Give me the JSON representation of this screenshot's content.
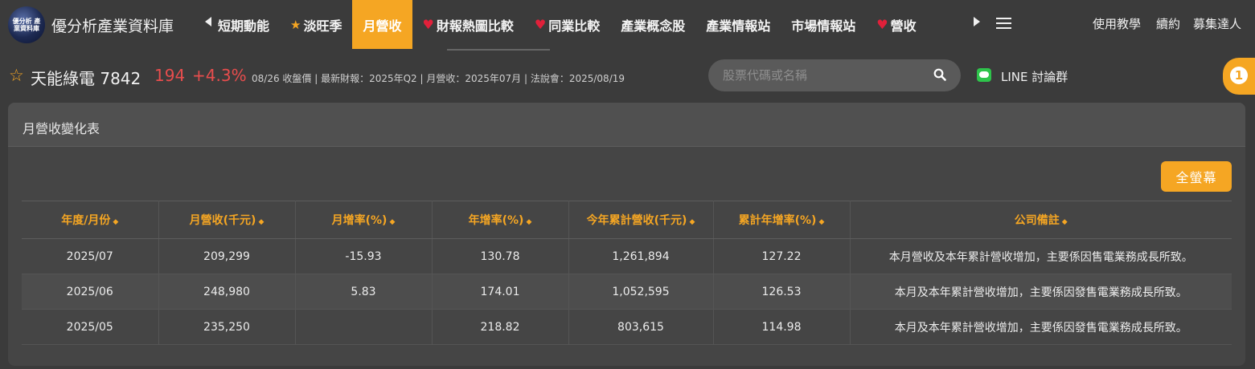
{
  "brand": {
    "logo_text": "優分析 產業資料庫",
    "name": "優分析產業資料庫"
  },
  "nav": {
    "items": [
      {
        "label": "短期動能",
        "icon": "",
        "active": false
      },
      {
        "label": "淡旺季",
        "icon": "star-icon",
        "active": false
      },
      {
        "label": "月營收",
        "icon": "",
        "active": true
      },
      {
        "label": "財報熱圖比較",
        "icon": "heart-icon",
        "active": false
      },
      {
        "label": "同業比較",
        "icon": "heart-icon",
        "active": false
      },
      {
        "label": "產業概念股",
        "icon": "",
        "active": false
      },
      {
        "label": "產業情報站",
        "icon": "",
        "active": false
      },
      {
        "label": "市場情報站",
        "icon": "",
        "active": false
      },
      {
        "label": "營收",
        "icon": "heart-icon",
        "active": false
      }
    ],
    "right": [
      "使用教學",
      "續約",
      "募集達人"
    ]
  },
  "stock": {
    "name": "天能綠電 7842",
    "price": "194",
    "change": "+4.3%",
    "meta": "08/26 收盤價 | 最新財報：2025年Q2 | 月營收：2025年07月 | 法說會：2025/08/19"
  },
  "search": {
    "placeholder": "股票代碼或名稱"
  },
  "line_group": {
    "label": "LINE 討論群"
  },
  "side_badge": "1",
  "panel": {
    "title": "月營收變化表",
    "fullscreen_label": "全螢幕"
  },
  "table": {
    "headers": [
      "年度/月份",
      "月營收(千元)",
      "月增率(%)",
      "年增率(%)",
      "今年累計營收(千元)",
      "累計年增率(%)",
      "公司備註"
    ],
    "rows": [
      [
        "2025/07",
        "209,299",
        "-15.93",
        "130.78",
        "1,261,894",
        "127.22",
        "本月營收及本年累計營收增加，主要係因售電業務成長所致。"
      ],
      [
        "2025/06",
        "248,980",
        "5.83",
        "174.01",
        "1,052,595",
        "126.53",
        "本月及本年累計營收增加，主要係因發售電業務成長所致。"
      ],
      [
        "2025/05",
        "235,250",
        "",
        "218.82",
        "803,615",
        "114.98",
        "本月及本年累計營收增加，主要係因發售電業務成長所致。"
      ]
    ]
  },
  "colors": {
    "accent": "#f5a623",
    "price_up": "#e84d4d",
    "background": "#3b3b3b",
    "panel": "#454545"
  }
}
